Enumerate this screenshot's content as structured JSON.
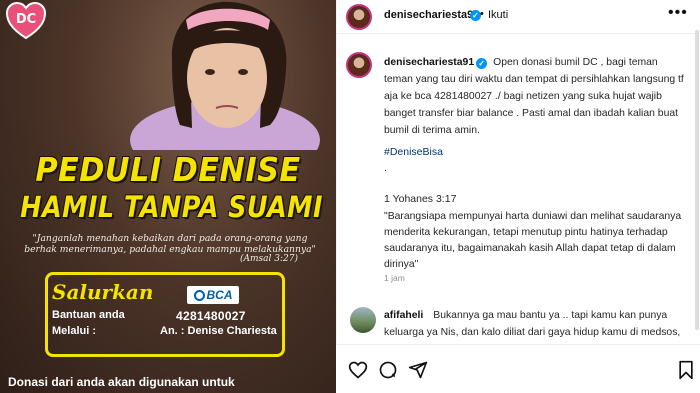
{
  "post_image": {
    "logo_text": "DC",
    "title_line_1": "PEDULI DENISE",
    "title_line_2": "HAMIL TANPA SUAMI",
    "quote": "\"Janganlah menahan kebaikan dari pada orang-orang yang berhak menerimanya, padahal engkau mampu melakukannya\"",
    "quote_source": "(Amsal 3:27)",
    "salurkan": "Salurkan",
    "bantuan_label": "Bantuan anda",
    "melalui_label": "Melalui :",
    "bank_name": "BCA",
    "account_number": "4281480027",
    "account_name": "An. : Denise Chariesta",
    "footer": "Donasi dari anda akan digunakan untuk"
  },
  "header": {
    "username": "denisechariesta91",
    "separator": "•",
    "follow_label": "Ikuti",
    "more_label": "•••"
  },
  "caption": {
    "username": "denisechariesta91",
    "text": "Open donasi bumil DC , bagi teman teman yang tau diri waktu dan tempat di persihlahkan langsung tf aja ke bca 4281480027 ./ bagi netizen yang suka hujat wajib banget transfer biar balance . Pasti amal dan ibadah kalian buat bumil di terima amin.",
    "hashtag": "#DeniseBisa",
    "dot": ".",
    "verse_ref": "1 Yohanes 3:17",
    "verse": "\"Barangsiapa mempunyai harta duniawi dan melihat saudaranya menderita kekurangan, tetapi menutup pintu hatinya terhadap saudaranya itu, bagaimanakah kasih Allah dapat tetap di dalam dirinya\"",
    "time": "1 jam"
  },
  "comment": {
    "username": "afifaheli",
    "text": "Bukannya ga mau bantu ya .. tapi kamu kan punya keluarga ya Nis, dan kalo diliat dari gaya hidup kamu di medsos, kamu bukan yang hidup susah? bangetttttt.. masih ada usaha"
  },
  "actions": [
    "heart-icon",
    "comment-icon",
    "share-icon",
    "bookmark-icon"
  ],
  "colors": {
    "accent_yellow": "#f4e400",
    "verified_blue": "#0095f6",
    "hashtag_blue": "#00376b",
    "bca_blue": "#0060af"
  }
}
